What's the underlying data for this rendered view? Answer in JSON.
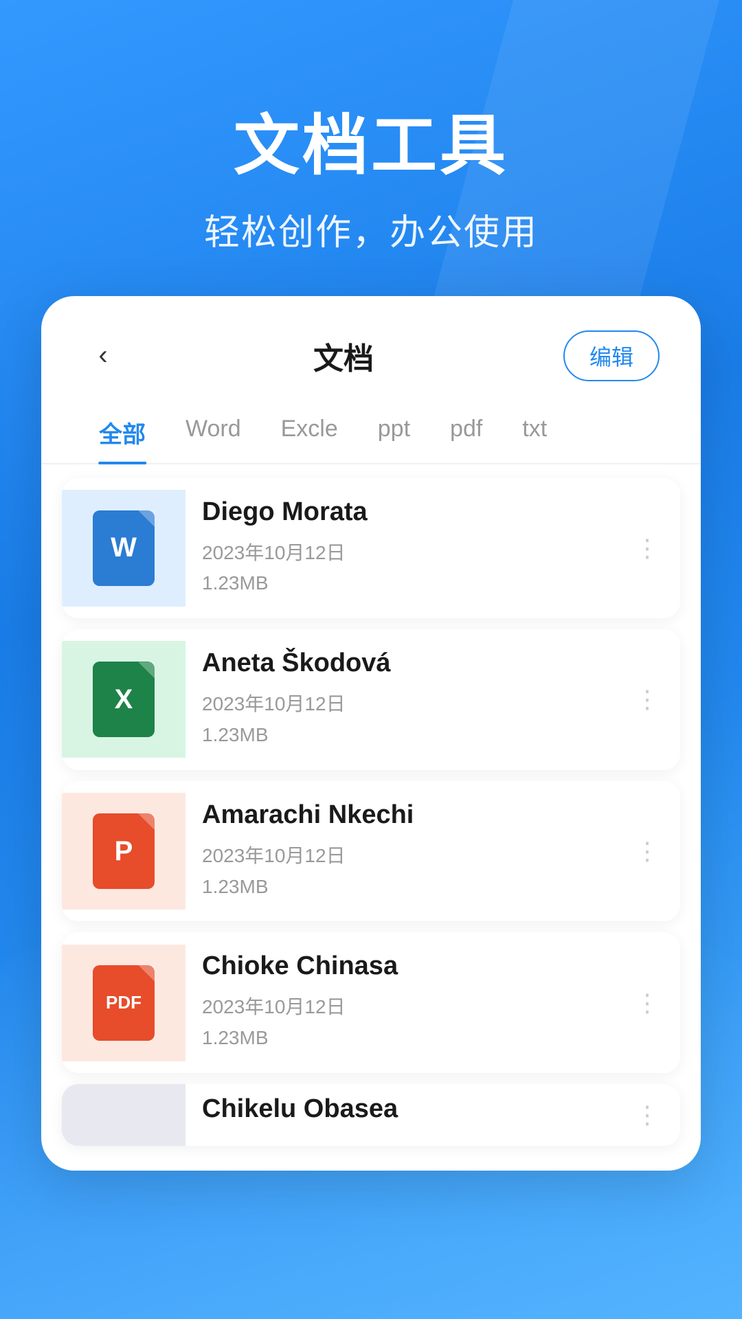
{
  "app": {
    "main_title": "文档工具",
    "sub_title": "轻松创作，办公使用"
  },
  "card": {
    "title": "文档",
    "back_label": "‹",
    "edit_label": "编辑"
  },
  "tabs": [
    {
      "label": "全部",
      "active": true
    },
    {
      "label": "Word",
      "active": false
    },
    {
      "label": "Excle",
      "active": false
    },
    {
      "label": "ppt",
      "active": false
    },
    {
      "label": "pdf",
      "active": false
    },
    {
      "label": "txt",
      "active": false
    }
  ],
  "files": [
    {
      "name": "Diego Morata",
      "date": "2023年10月12日",
      "size": "1.23MB",
      "type": "word",
      "icon_letter": "W",
      "icon_bg": "word-bg",
      "icon_class": "word-icon"
    },
    {
      "name": "Aneta Škodová",
      "date": "2023年10月12日",
      "size": "1.23MB",
      "type": "excel",
      "icon_letter": "X",
      "icon_bg": "excel-bg",
      "icon_class": "excel-icon"
    },
    {
      "name": "Amarachi Nkechi",
      "date": "2023年10月12日",
      "size": "1.23MB",
      "type": "ppt",
      "icon_letter": "P",
      "icon_bg": "ppt-bg",
      "icon_class": "ppt-icon"
    },
    {
      "name": "Chioke Chinasa",
      "date": "2023年10月12日",
      "size": "1.23MB",
      "type": "pdf",
      "icon_letter": "PDF",
      "icon_bg": "pdf-bg",
      "icon_class": "pdf-icon"
    }
  ],
  "partial_file": {
    "name": "Chikelu Obasea"
  },
  "icons": {
    "back": "‹",
    "more": "⋮"
  }
}
